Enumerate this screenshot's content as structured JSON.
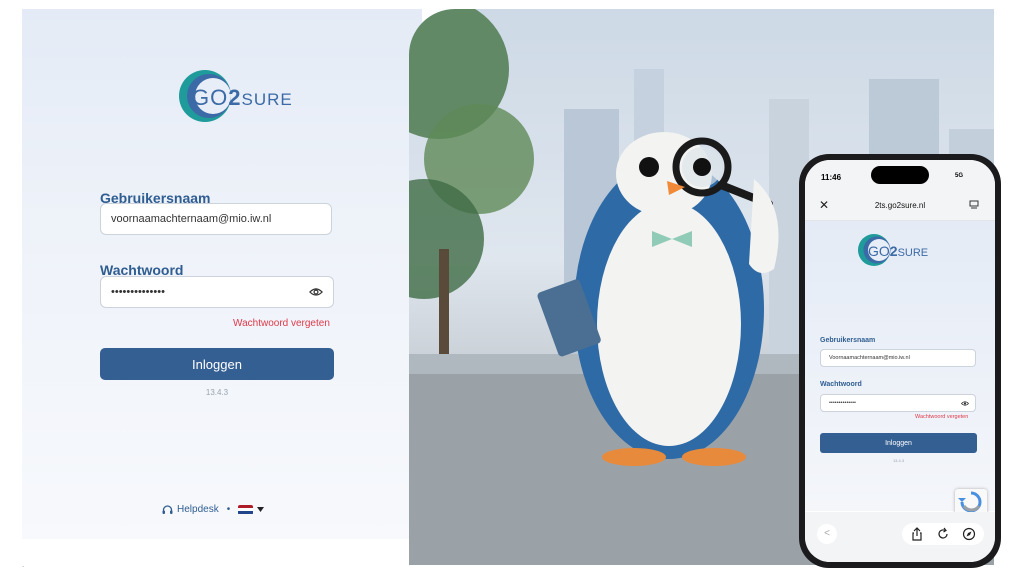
{
  "logo": {
    "go": "GO",
    "two": "2",
    "sure": "SURE"
  },
  "form": {
    "username_label": "Gebruikersnaam",
    "username_value": "voornaamachternaam@mio.iw.nl",
    "password_label": "Wachtwoord",
    "password_value": "••••••••••••••",
    "forgot_label": "Wachtwoord vergeten",
    "login_label": "Inloggen",
    "version": "13.4.3"
  },
  "footer": {
    "helpdesk_label": "Helpdesk",
    "separator": "•",
    "language": "Dutch (NL flag)"
  },
  "colors": {
    "accent": "#345f92",
    "label": "#2f5d91",
    "forgot": "#e0394a",
    "logo_teal": "#1e9b9a"
  },
  "phone": {
    "time": "11:46",
    "url": "2ts.go2sure.nl",
    "signal": "5G",
    "logo": {
      "go": "GO",
      "two": "2",
      "sure": "SURE"
    },
    "username_label": "Gebruikersnaam",
    "username_value": "Voornaamachternaam@mio.iw.nl",
    "password_label": "Wachtwoord",
    "password_value": "••••••••••••••",
    "forgot_label": "Wachtwoord vergeten",
    "login_label": "Inloggen",
    "version": "13.4.3"
  },
  "hero": {
    "subject": "penguin mascot with magnifying glass",
    "setting": "city waterfront"
  }
}
